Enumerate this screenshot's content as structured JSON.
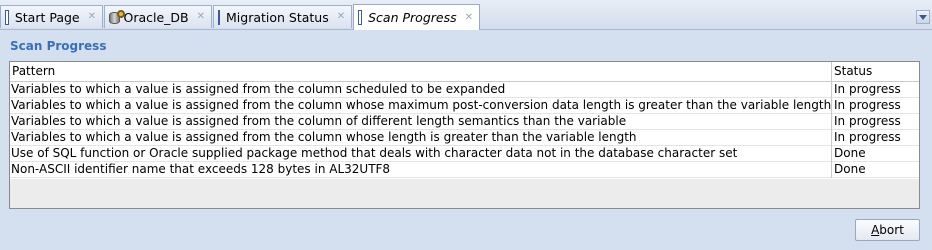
{
  "tabs": [
    {
      "label": "Start Page",
      "icon": "document-icon",
      "active": false
    },
    {
      "label": "Oracle_DB",
      "icon": "database-icon",
      "active": false
    },
    {
      "label": "Migration Status",
      "icon": "document-icon",
      "active": false
    },
    {
      "label": "Scan Progress",
      "icon": "document-icon",
      "active": true
    }
  ],
  "tab_close_glyph": "✕",
  "heading": "Scan Progress",
  "table": {
    "columns": [
      "Pattern",
      "Status"
    ],
    "rows": [
      {
        "pattern": "Variables to which a value is assigned from the column scheduled to be expanded",
        "status": "In progress"
      },
      {
        "pattern": "Variables to which a value is assigned from the column whose maximum post-conversion data length is greater than the variable length",
        "status": "In progress"
      },
      {
        "pattern": "Variables to which a value is assigned from the column of different length semantics than the variable",
        "status": "In progress"
      },
      {
        "pattern": "Variables to which a value is assigned from the column whose length is greater than the variable length",
        "status": "In progress"
      },
      {
        "pattern": "Use of SQL function or Oracle supplied package method that deals with character data not in the database character set",
        "status": "Done"
      },
      {
        "pattern": "Non-ASCII identifier name that exceeds 128 bytes in AL32UTF8",
        "status": "Done"
      }
    ]
  },
  "abort_button": {
    "mnemonic": "A",
    "rest": "bort"
  },
  "colors": {
    "heading": "#3b6fb6",
    "background": "#d4dff0"
  }
}
